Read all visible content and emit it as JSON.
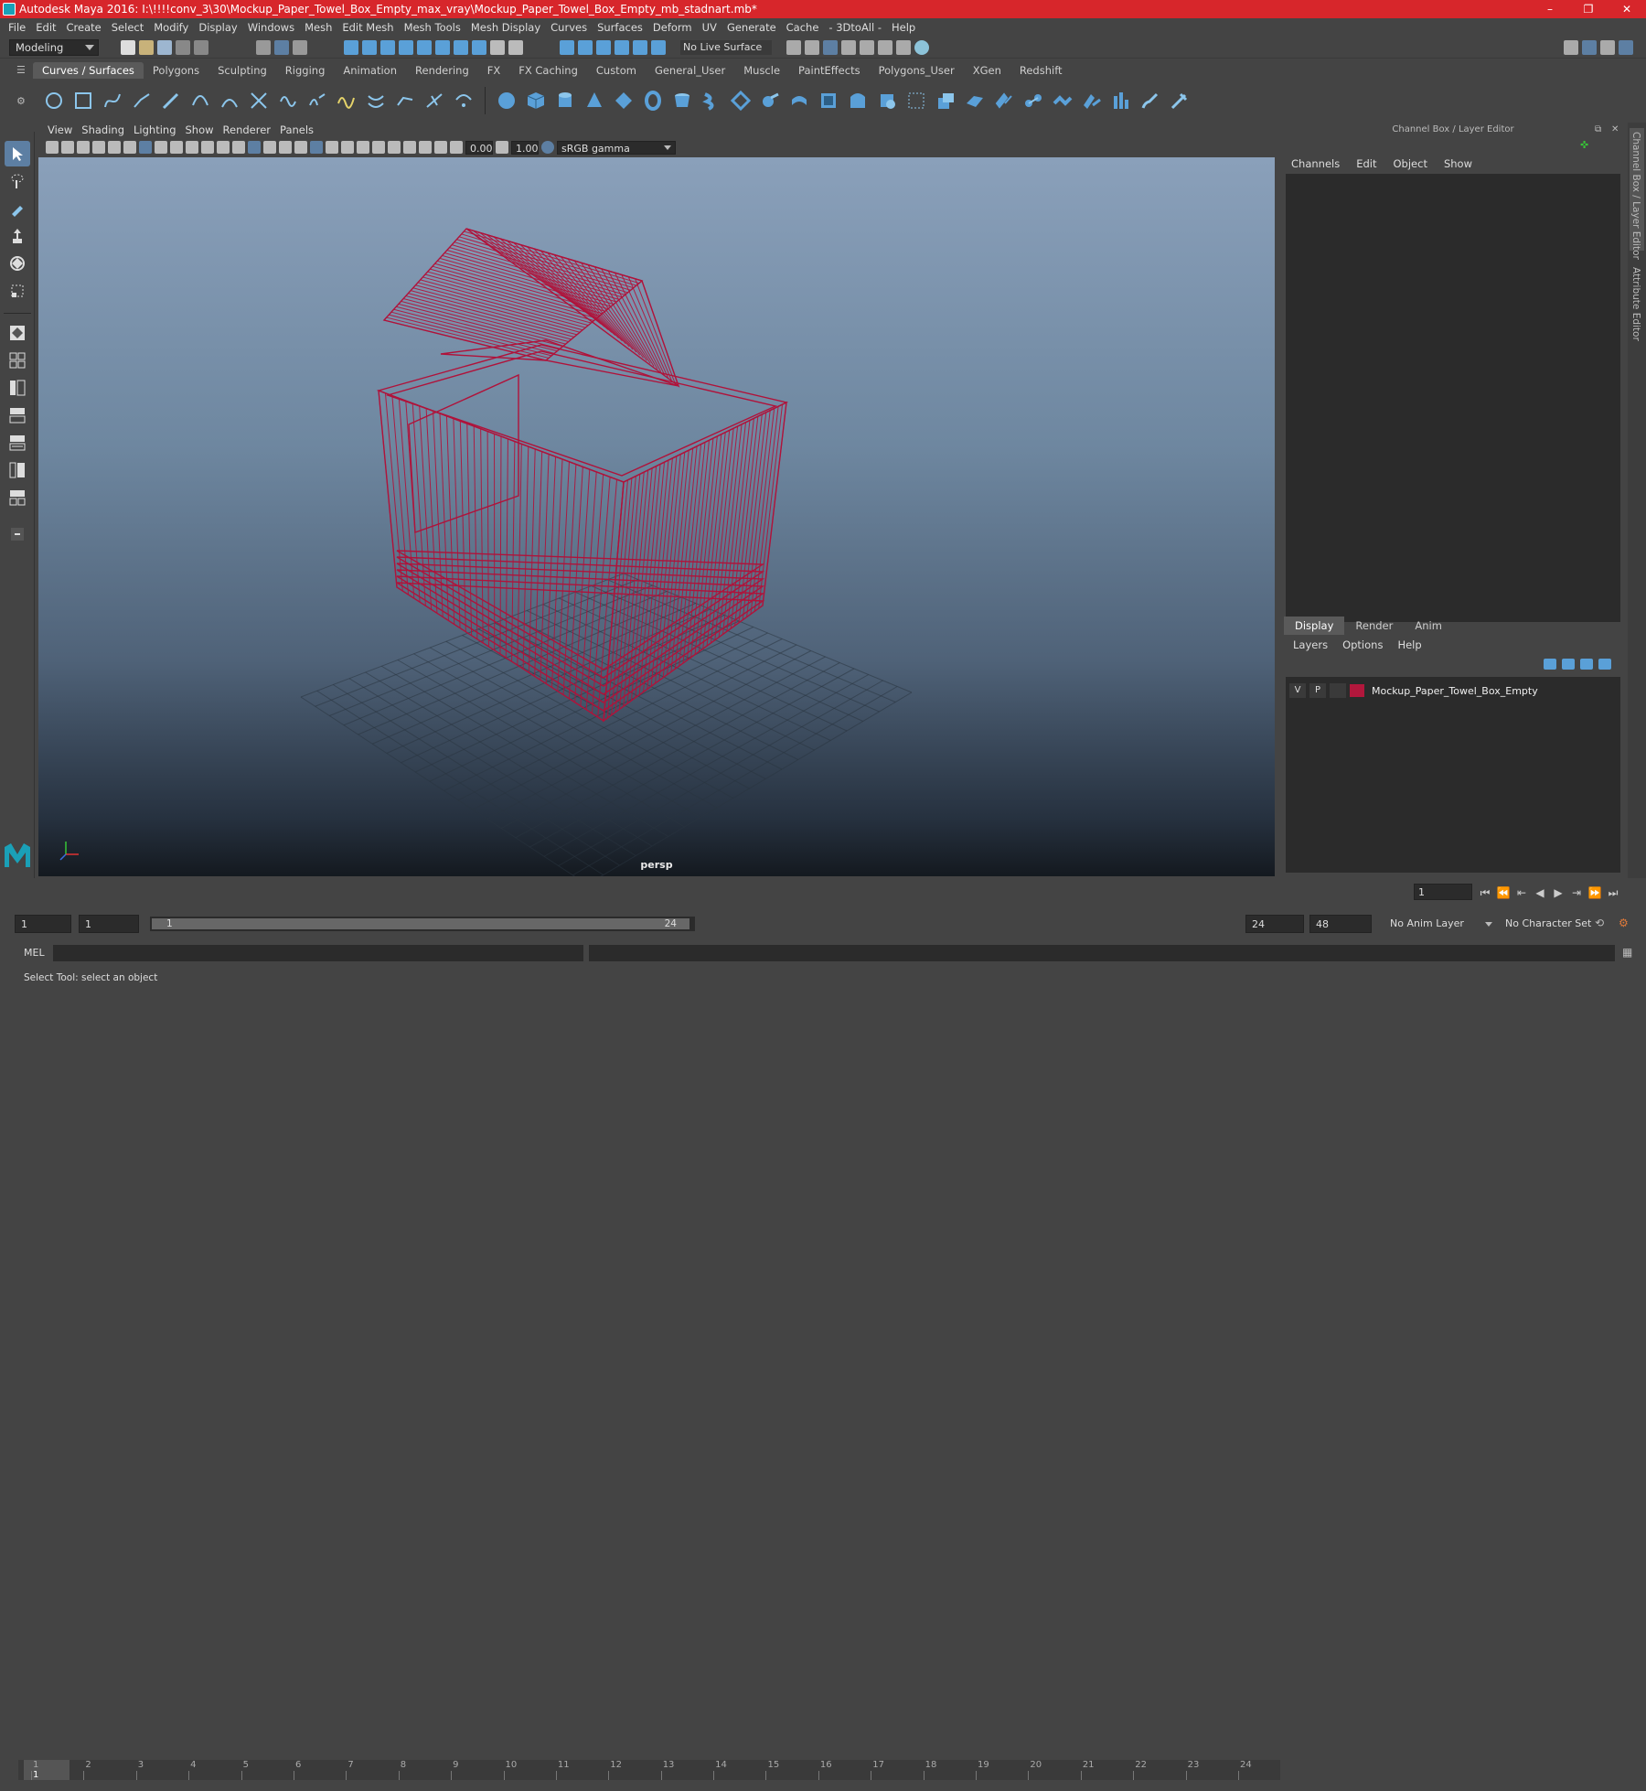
{
  "window": {
    "title": "Autodesk Maya 2016: I:\\!!!!conv_3\\30\\Mockup_Paper_Towel_Box_Empty_max_vray\\Mockup_Paper_Towel_Box_Empty_mb_stadnart.mb*",
    "minimize": "–",
    "restore": "❐",
    "close": "✕"
  },
  "menus": [
    "File",
    "Edit",
    "Create",
    "Select",
    "Modify",
    "Display",
    "Windows",
    "Mesh",
    "Edit Mesh",
    "Mesh Tools",
    "Mesh Display",
    "Curves",
    "Surfaces",
    "Deform",
    "UV",
    "Generate",
    "Cache",
    "- 3DtoAll -",
    "Help"
  ],
  "status_line": {
    "mode": "Modeling",
    "live_surface": "No Live Surface"
  },
  "shelf_tabs": [
    "Curves / Surfaces",
    "Polygons",
    "Sculpting",
    "Rigging",
    "Animation",
    "Rendering",
    "FX",
    "FX Caching",
    "Custom",
    "General_User",
    "Muscle",
    "PaintEffects",
    "Polygons_User",
    "XGen",
    "Redshift"
  ],
  "shelf_active_tab": "Curves / Surfaces",
  "viewport": {
    "menus": [
      "View",
      "Shading",
      "Lighting",
      "Show",
      "Renderer",
      "Panels"
    ],
    "exposure": "0.00",
    "gamma": "1.00",
    "color_space": "sRGB gamma",
    "camera": "persp",
    "wire_color": "#b0123a"
  },
  "channel_box": {
    "header": "Channel Box / Layer Editor",
    "menus": [
      "Channels",
      "Edit",
      "Object",
      "Show"
    ]
  },
  "layer_editor": {
    "tabs": [
      "Display",
      "Render",
      "Anim"
    ],
    "active_tab": "Display",
    "menus": [
      "Layers",
      "Options",
      "Help"
    ],
    "layers": [
      {
        "visible": "V",
        "playback": "P",
        "name": "Mockup_Paper_Towel_Box_Empty",
        "color": "#b2173c"
      }
    ]
  },
  "side_tabs": [
    "Channel Box / Layer Editor",
    "Attribute Editor"
  ],
  "timeline": {
    "ticks": [
      "1",
      "2",
      "3",
      "4",
      "5",
      "6",
      "7",
      "8",
      "9",
      "10",
      "11",
      "12",
      "13",
      "14",
      "15",
      "16",
      "17",
      "18",
      "19",
      "20",
      "21",
      "22",
      "23",
      "24"
    ],
    "current_frame_marker": "1",
    "current_frame_field": "1"
  },
  "range": {
    "start": "1",
    "playback_start": "1",
    "slider_start": "1",
    "slider_end": "24",
    "playback_end": "24",
    "end": "48",
    "anim_layer": "No Anim Layer",
    "character_set": "No Character Set"
  },
  "command_line": {
    "label": "MEL"
  },
  "help_line": "Select Tool: select an object"
}
